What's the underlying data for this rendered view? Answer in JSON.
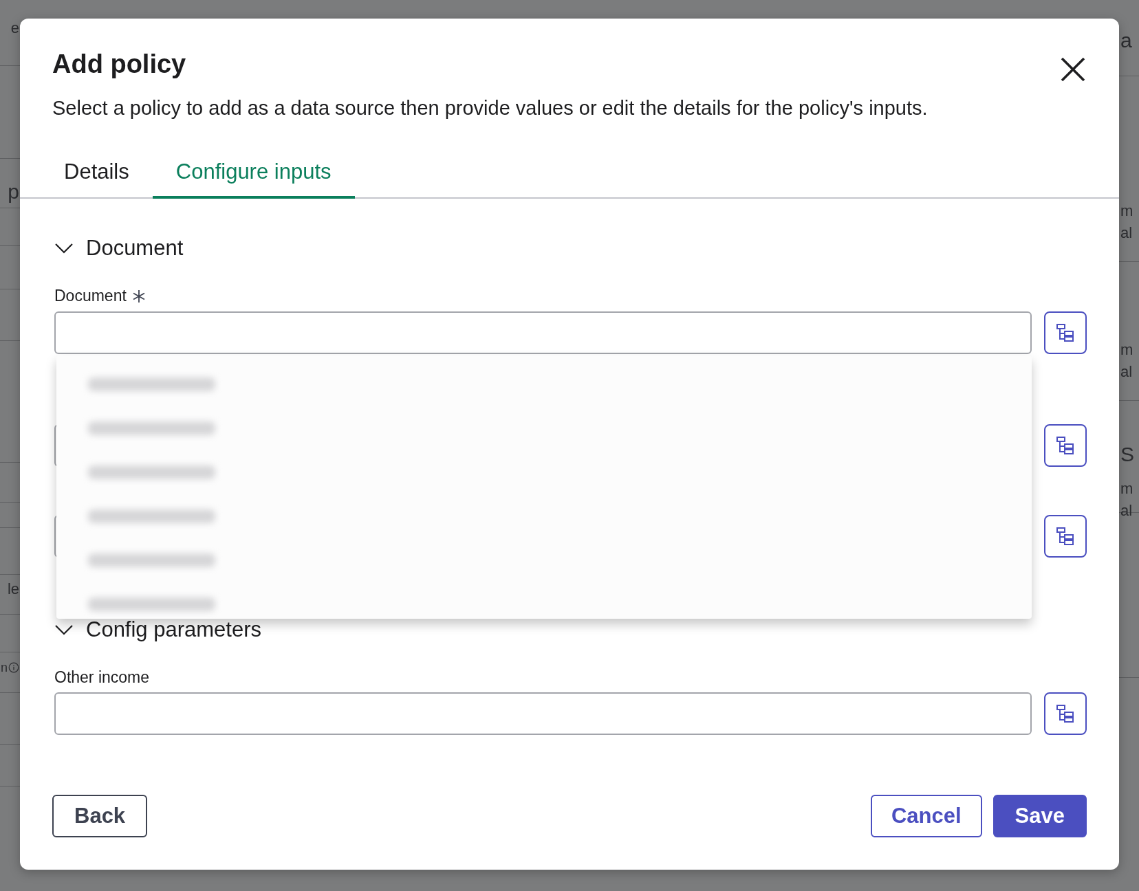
{
  "background": {
    "left_fragments": [
      {
        "text": "e",
        "kind": "text"
      },
      {
        "text": "p",
        "kind": "heading"
      },
      {
        "text": "le",
        "kind": "text"
      },
      {
        "text": "n",
        "kind": "text",
        "info_icon": true
      }
    ],
    "right_fragments": [
      {
        "text": "a",
        "kind": "heading"
      },
      {
        "text": "m",
        "kind": "text"
      },
      {
        "text": "al",
        "kind": "text"
      },
      {
        "text": "m",
        "kind": "text"
      },
      {
        "text": "al",
        "kind": "text"
      },
      {
        "text": "S",
        "kind": "heading"
      },
      {
        "text": "m",
        "kind": "text"
      },
      {
        "text": "al",
        "kind": "text"
      }
    ]
  },
  "dialog": {
    "title": "Add policy",
    "description": "Select a policy to add as a data source then provide values or edit the details for the policy's inputs.",
    "tabs": [
      {
        "label": "Details",
        "selected": false
      },
      {
        "label": "Configure inputs",
        "selected": true
      }
    ],
    "sections": [
      {
        "title": "Document",
        "expanded": true,
        "fields": [
          {
            "kind": "input",
            "label": "Document",
            "required": true,
            "dropdown": {
              "options": [
                {
                  "kind": "blurred"
                },
                {
                  "kind": "blurred"
                },
                {
                  "kind": "blurred"
                },
                {
                  "kind": "blurred"
                },
                {
                  "kind": "blurred"
                },
                {
                  "kind": "blurred"
                }
              ]
            }
          },
          {
            "kind": "input"
          },
          {
            "kind": "input"
          }
        ]
      },
      {
        "title": "Config parameters",
        "expanded": true,
        "fields": [
          {
            "kind": "input",
            "label": "Other income"
          }
        ]
      }
    ],
    "buttons": [
      {
        "label": "Back",
        "kind": "secondary"
      },
      {
        "label": "Cancel",
        "kind": "outline"
      },
      {
        "label": "Save",
        "kind": "primary"
      }
    ]
  }
}
